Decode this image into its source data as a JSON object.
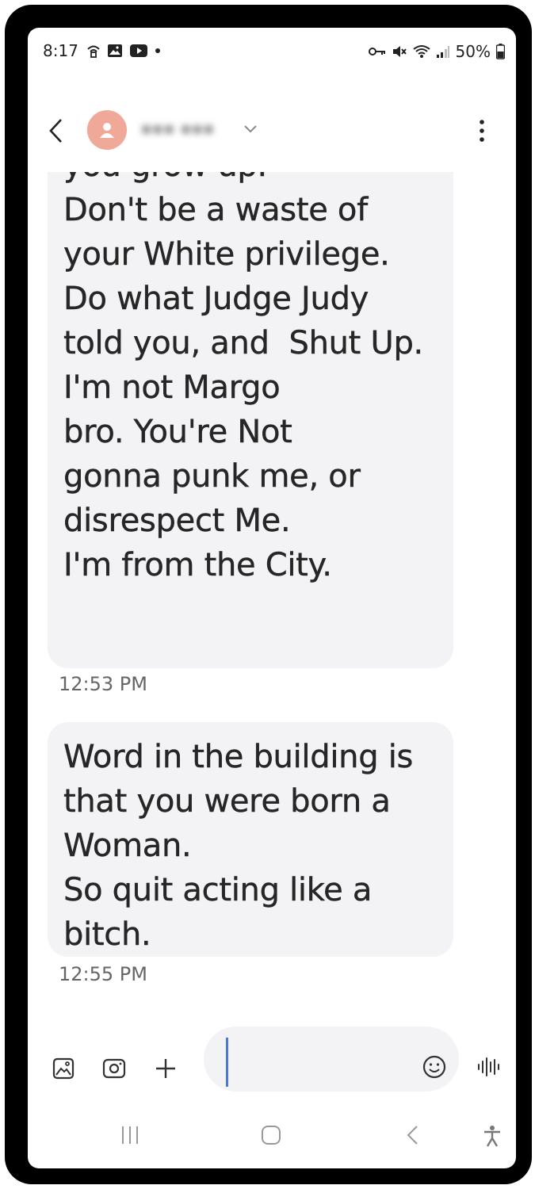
{
  "status_bar": {
    "time": "8:17",
    "battery": "50%"
  },
  "header": {
    "contact_name": "■■■ ■■■"
  },
  "messages": [
    {
      "text": "you grow up.\nDon't be a waste of\nyour White privilege.\nDo what Judge Judy\ntold you, and  Shut Up.\nI'm not Margo\nbro. You're Not\ngonna punk me, or\ndisrespect Me.\nI'm from the City.",
      "time": "12:53 PM"
    },
    {
      "text": "Word in the building is\nthat you were born a\nWoman.\nSo quit acting like a\nbitch.",
      "time": "12:55 PM"
    }
  ],
  "compose": {
    "placeholder": ""
  },
  "icons": {
    "status_left": [
      "wifi-calling-icon",
      "gallery-notification-icon",
      "youtube-icon",
      "dot-icon"
    ],
    "status_right": [
      "vpn-key-icon",
      "mute-icon",
      "wifi-icon",
      "signal-icon",
      "battery-icon"
    ],
    "compose": [
      "gallery-icon",
      "camera-icon",
      "plus-icon",
      "emoji-icon",
      "voice-record-icon"
    ],
    "nav": [
      "recents-icon",
      "home-icon",
      "back-nav-icon",
      "accessibility-icon"
    ]
  },
  "colors": {
    "avatar": "#f0a898",
    "bubble": "#f3f3f5",
    "cursor": "#4a78d8",
    "frame": "#000000"
  }
}
